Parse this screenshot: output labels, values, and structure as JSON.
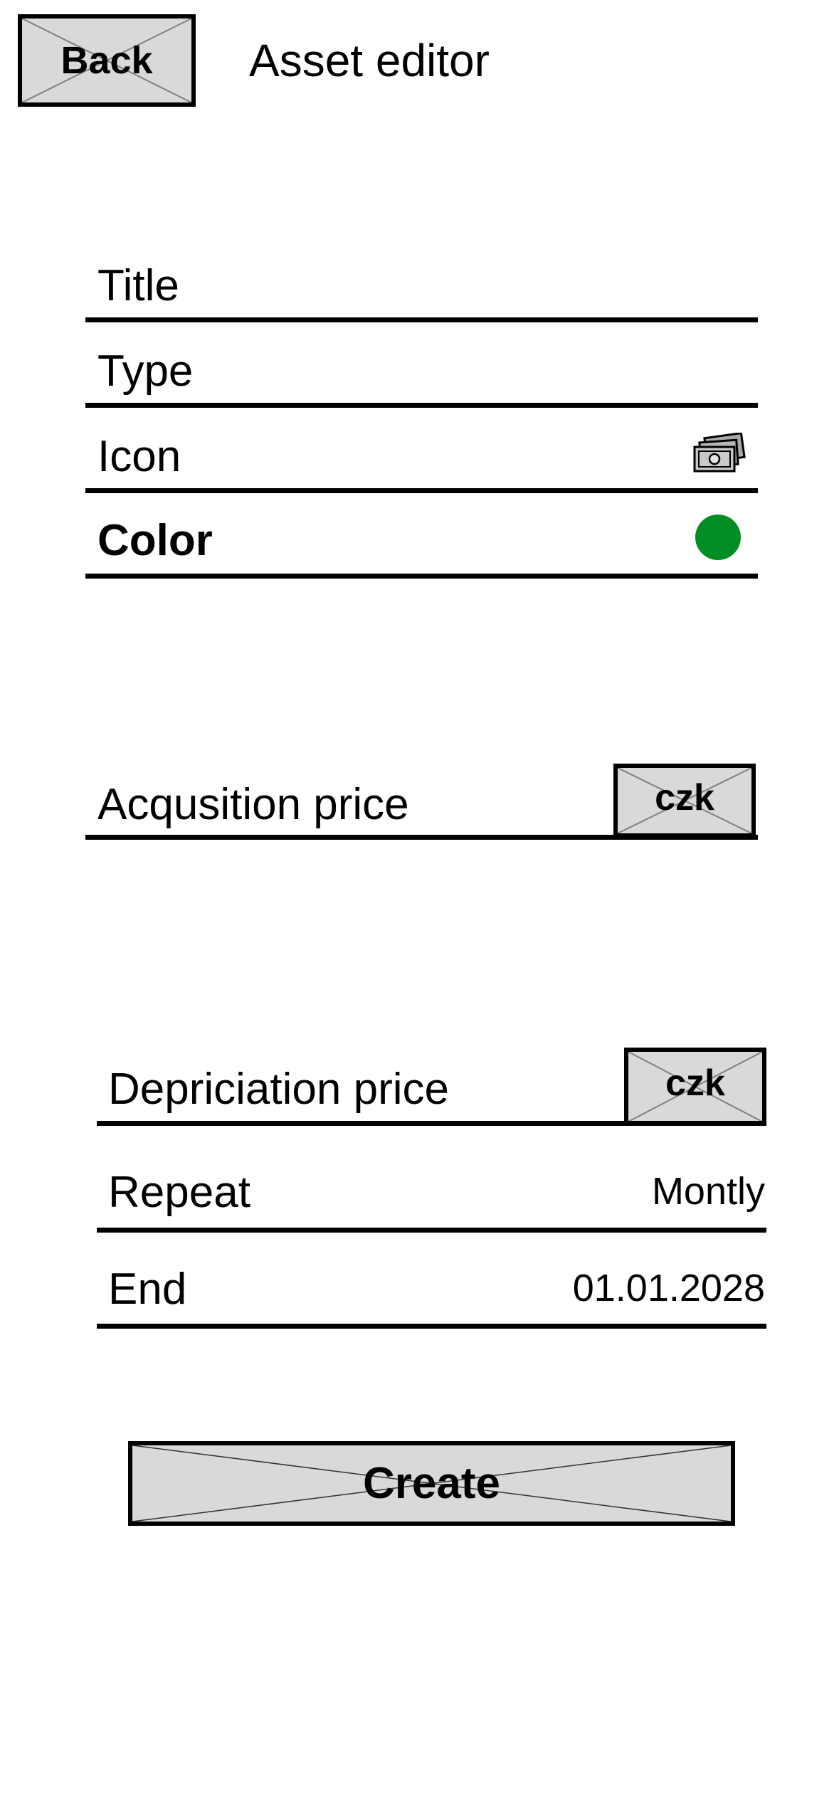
{
  "header": {
    "back_label": "Back",
    "title": "Asset editor"
  },
  "form": {
    "title_label": "Title",
    "type_label": "Type",
    "icon_label": "Icon",
    "icon_name": "cash-stack-icon",
    "color_label": "Color",
    "color_value": "#028e25"
  },
  "acquisition": {
    "label": "Acqusition price",
    "currency": "czk"
  },
  "depreciation": {
    "label": "Depriciation price",
    "currency": "czk",
    "repeat_label": "Repeat",
    "repeat_value": "Montly",
    "end_label": "End",
    "end_value": "01.01.2028"
  },
  "actions": {
    "create_label": "Create"
  }
}
